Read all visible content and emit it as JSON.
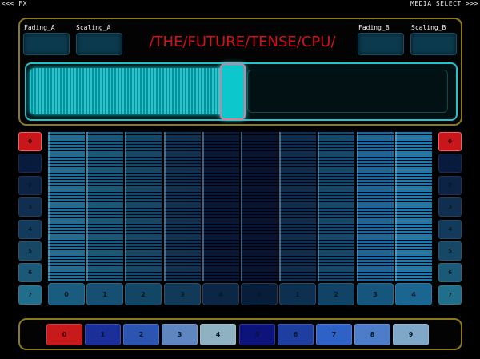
{
  "nav": {
    "left": "<<< FX",
    "right": "MEDIA SELECT >>>"
  },
  "header": {
    "title": "/THE/FUTURE/TENSE/CPU/",
    "fading_a": "Fading_A",
    "scaling_a": "Scaling_A",
    "fading_b": "Fading_B",
    "scaling_b": "Scaling_B"
  },
  "crossfader": {
    "position": 0.45
  },
  "left_bank": {
    "labels": [
      "0",
      "1",
      "2",
      "3",
      "4",
      "5",
      "6",
      "7"
    ],
    "active": 0
  },
  "right_bank": {
    "labels": [
      "0",
      "1",
      "2",
      "3",
      "4",
      "5",
      "6",
      "7"
    ],
    "active": 0
  },
  "faders": {
    "labels": [
      "0",
      "1",
      "2",
      "3",
      "4",
      "0",
      "1",
      "2",
      "3",
      "4"
    ],
    "colors": [
      "#1a6e9a",
      "#135a82",
      "#0f4a6e",
      "#0c3356",
      "#07193a",
      "#061535",
      "#0a2f52",
      "#0f4a73",
      "#1666a0",
      "#1a7bb0"
    ],
    "button_colors": [
      "#1a5b80",
      "#174f72",
      "#134564",
      "#103a57",
      "#0b2745",
      "#081d3a",
      "#0d3050",
      "#114366",
      "#16567c",
      "#1a6690"
    ]
  },
  "presets": {
    "labels": [
      "0",
      "1",
      "2",
      "3",
      "4",
      "5",
      "6",
      "7",
      "8",
      "9"
    ],
    "colors": [
      "#c81a1a",
      "#1a2f9a",
      "#2b55b0",
      "#5f86c0",
      "#8fb2c2",
      "#0c137a",
      "#1e3fa0",
      "#2f62c6",
      "#4d7dc8",
      "#7fa8c8"
    ]
  },
  "colors": {
    "panel_border": "#8a7a18",
    "accent_red": "#d4101c",
    "cyan": "#25c3cc"
  }
}
